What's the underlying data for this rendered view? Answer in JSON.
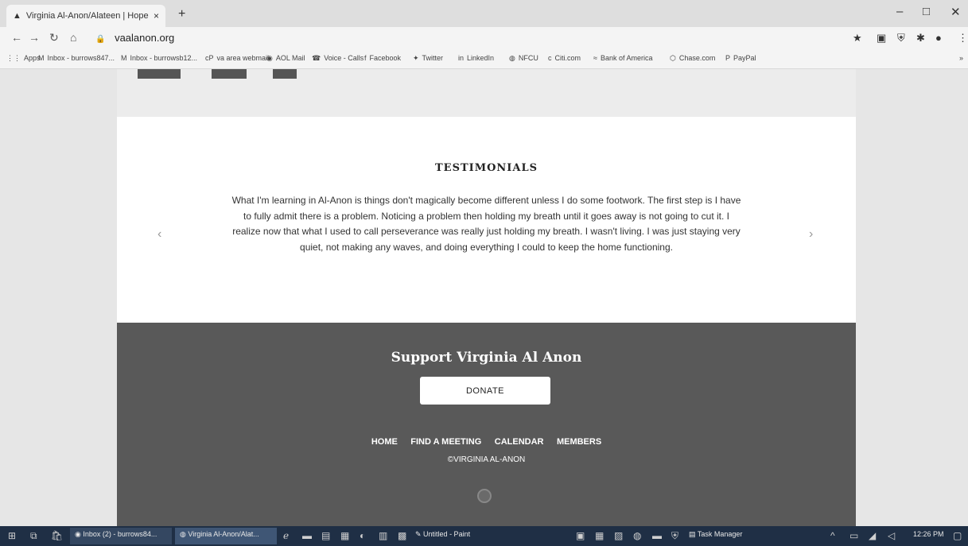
{
  "browser": {
    "tab_title": "Virginia Al-Anon/Alateen | Hope",
    "tab_close": "×",
    "new_tab": "+",
    "url": "vaalanon.org",
    "window_controls": [
      "–",
      "□",
      "✕"
    ]
  },
  "bookmarks": [
    {
      "icon": "apps-icon",
      "label": "Apps"
    },
    {
      "icon": "gmail-icon",
      "label": "Inbox - burrows847..."
    },
    {
      "icon": "gmail-icon",
      "label": "Inbox - burrowsb12..."
    },
    {
      "icon": "webmail-icon",
      "label": "va area webmail"
    },
    {
      "icon": "aol-icon",
      "label": "AOL Mail"
    },
    {
      "icon": "voice-icon",
      "label": "Voice - Calls"
    },
    {
      "icon": "facebook-icon",
      "label": "Facebook"
    },
    {
      "icon": "twitter-icon",
      "label": "Twitter"
    },
    {
      "icon": "linkedin-icon",
      "label": "LinkedIn"
    },
    {
      "icon": "globe-icon",
      "label": "NFCU"
    },
    {
      "icon": "citi-icon",
      "label": "Citi.com"
    },
    {
      "icon": "boa-icon",
      "label": "Bank of America"
    },
    {
      "icon": "chase-icon",
      "label": "Chase.com"
    },
    {
      "icon": "paypal-icon",
      "label": "PayPal"
    }
  ],
  "testimonials": {
    "title": "TESTIMONIALS",
    "text": "What I'm learning in Al-Anon is things don't magically become different unless I do some footwork. The first step is I have to fully admit there is a problem. Noticing a problem then holding my breath until it goes away is not going to cut it. I realize now that what I used to call perseverance was really just holding my breath. I wasn't living. I was just staying very quiet, not making any waves, and doing everything I could to keep the home functioning.",
    "prev": "‹",
    "next": "›"
  },
  "footer": {
    "support_title": "Support Virginia Al Anon",
    "donate_label": "DONATE",
    "nav": [
      "HOME",
      "FIND A MEETING",
      "CALENDAR",
      "MEMBERS"
    ],
    "copyright": "©VIRGINIA AL-ANON"
  },
  "taskbar": {
    "inbox": "Inbox (2) - burrows84...",
    "chrome": "Virginia Al-Anon/Alat...",
    "paint": "Untitled - Paint",
    "taskmgr": "Task Manager",
    "time": "12:26 PM"
  }
}
